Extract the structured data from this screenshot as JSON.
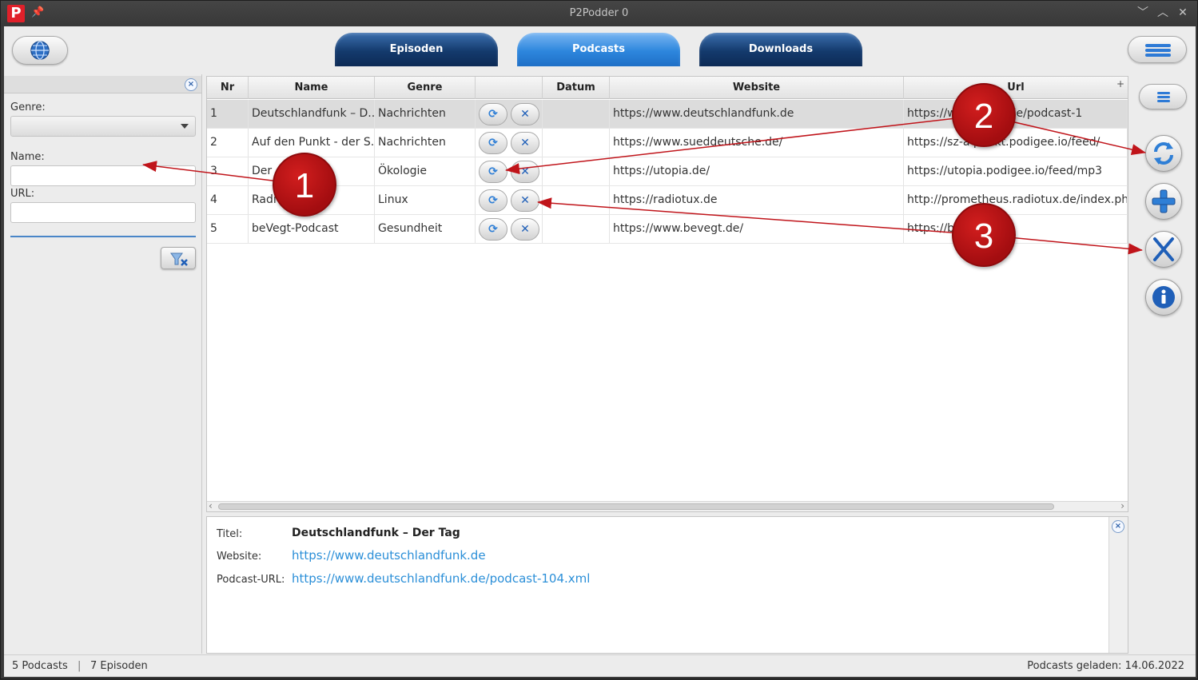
{
  "window": {
    "title": "P2Podder 0",
    "logo": "P",
    "controls": [
      "﹀",
      "︿",
      "✕"
    ]
  },
  "tabs": [
    {
      "label": "Episoden",
      "active": false
    },
    {
      "label": "Podcasts",
      "active": true
    },
    {
      "label": "Downloads",
      "active": false
    }
  ],
  "filter": {
    "genre_label": "Genre:",
    "name_label": "Name:",
    "url_label": "URL:",
    "genre_value": "",
    "name_value": "",
    "url_value": ""
  },
  "table": {
    "headers": [
      "Nr",
      "Name",
      "Genre",
      "",
      "Datum",
      "Website",
      "Url"
    ],
    "rows": [
      {
        "nr": "1",
        "name": "Deutschlandfunk – D...",
        "genre": "Nachrichten",
        "datum": "",
        "website": "https://www.deutschlandfunk.de",
        "url": "https://w          andfunk.de/podcast-1"
      },
      {
        "nr": "2",
        "name": "Auf den Punkt - der S...",
        "genre": "Nachrichten",
        "datum": "",
        "website": "https://www.sueddeutsche.de/",
        "url": "https://sz-a          punkt.podigee.io/feed/"
      },
      {
        "nr": "3",
        "name": "Der          cast –...",
        "genre": "Ökologie",
        "datum": "",
        "website": "https://utopia.de/",
        "url": "https://utopia.podigee.io/feed/mp3"
      },
      {
        "nr": "4",
        "name": "Radi",
        "genre": "Linux",
        "datum": "",
        "website": "https://radiotux.de",
        "url": "http://prometheus.radiotux.de/index.php?/"
      },
      {
        "nr": "5",
        "name": "beVegt-Podcast",
        "genre": "Gesundheit",
        "datum": "",
        "website": "https://www.bevegt.de/",
        "url": "https://be          com/rss"
      }
    ]
  },
  "details": {
    "title_label": "Titel:",
    "title_value": "Deutschlandfunk – Der Tag",
    "website_label": "Website:",
    "website_value": "https://www.deutschlandfunk.de",
    "url_label": "Podcast-URL:",
    "url_value": "https://www.deutschlandfunk.de/podcast-104.xml"
  },
  "status": {
    "podcasts": "5 Podcasts",
    "sep": "|",
    "episodes": "7 Episoden",
    "loaded": "Podcasts geladen: 14.06.2022"
  },
  "callouts": [
    "1",
    "2",
    "3"
  ],
  "icons": {
    "globe": "globe-icon",
    "menu": "menu-icon",
    "refresh": "refresh-icon",
    "add": "plus-icon",
    "delete": "x-icon",
    "info": "info-icon",
    "clear_filter": "filter-clear-icon"
  },
  "colors": {
    "accent": "#2d86dd",
    "tab_dark": "#143a6d",
    "callout": "#b01216",
    "link": "#2b8fd8"
  }
}
